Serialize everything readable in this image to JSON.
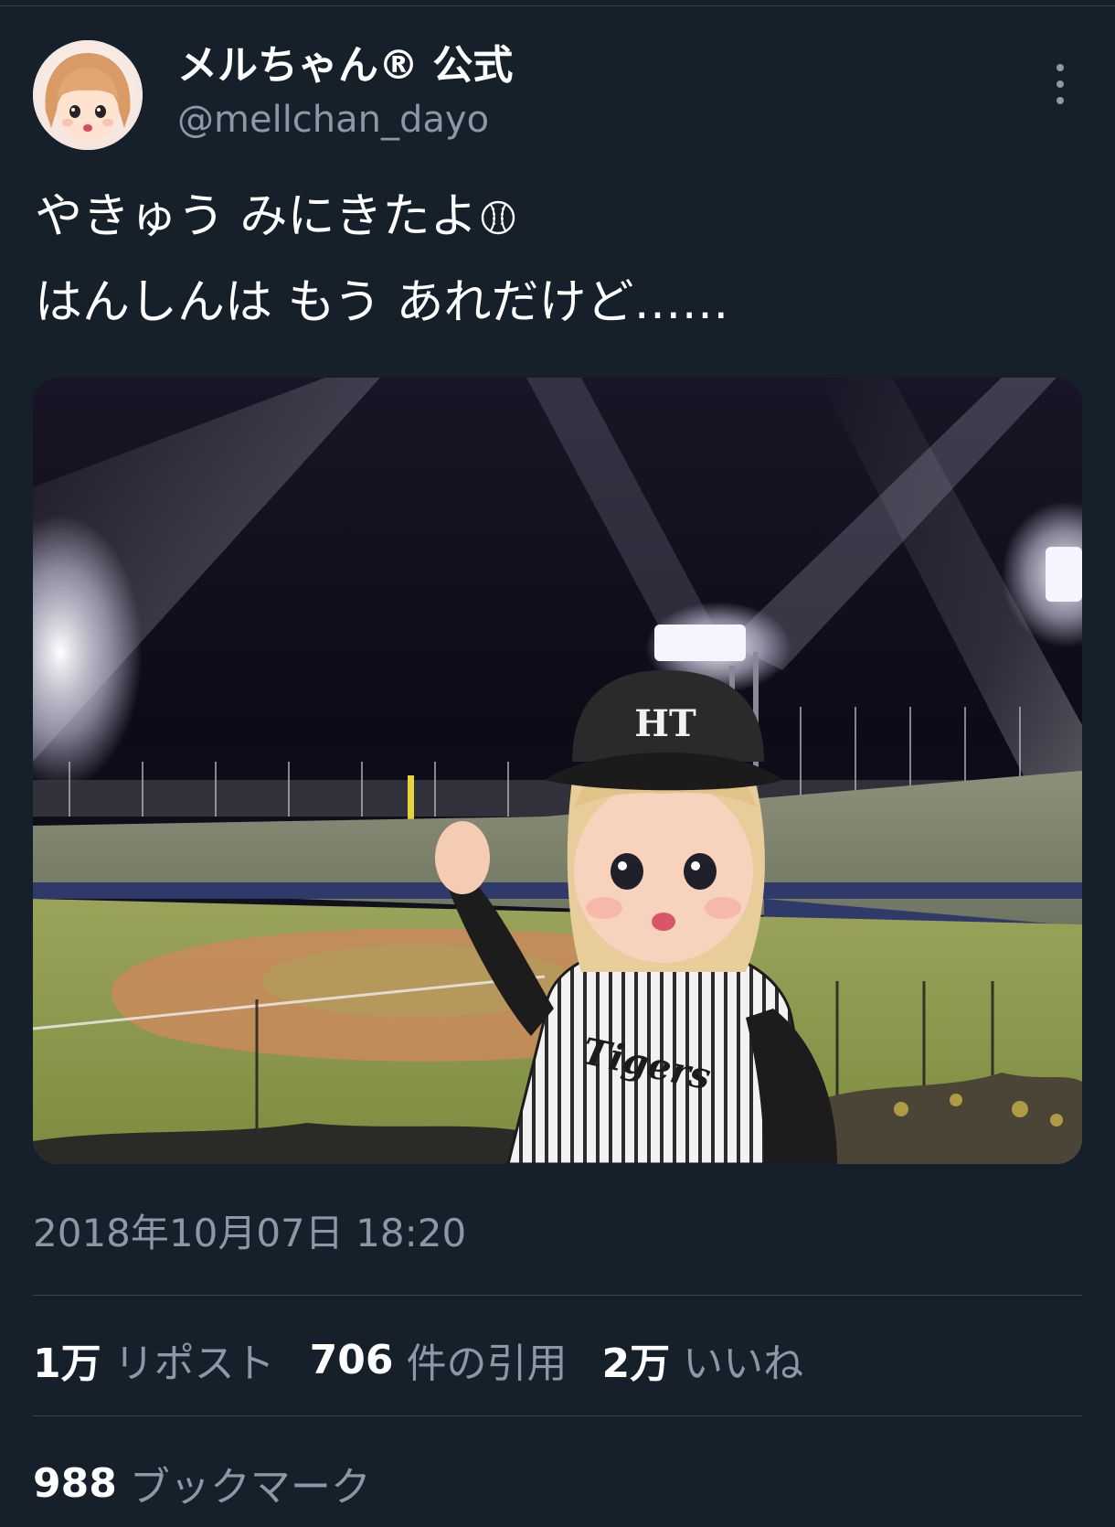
{
  "user": {
    "display_name": "メルちゃん® 公式",
    "handle": "@mellchan_dayo",
    "avatar_icon": "doll-avatar-icon"
  },
  "tweet": {
    "lines": [
      "やきゅう みにきたよ",
      "はんしんは もう あれだけど……"
    ],
    "emoji_icon": "baseball-icon",
    "photo_icon": "doll-at-baseball-stadium-photo",
    "photo_texts": {
      "cap_logo": "HT",
      "jersey_text": "Tigers"
    },
    "timestamp": "2018年10月07日 18:20"
  },
  "stats": {
    "reposts_count": "1万",
    "reposts_label": "リポスト",
    "quotes_count": "706",
    "quotes_label": "件の引用",
    "likes_count": "2万",
    "likes_label": "いいね",
    "bookmarks_count": "988",
    "bookmarks_label": "ブックマーク"
  },
  "colors": {
    "background": "#15202b",
    "primary_text": "#ffffff",
    "secondary_text": "#8b98a5",
    "divider": "#38444d"
  }
}
